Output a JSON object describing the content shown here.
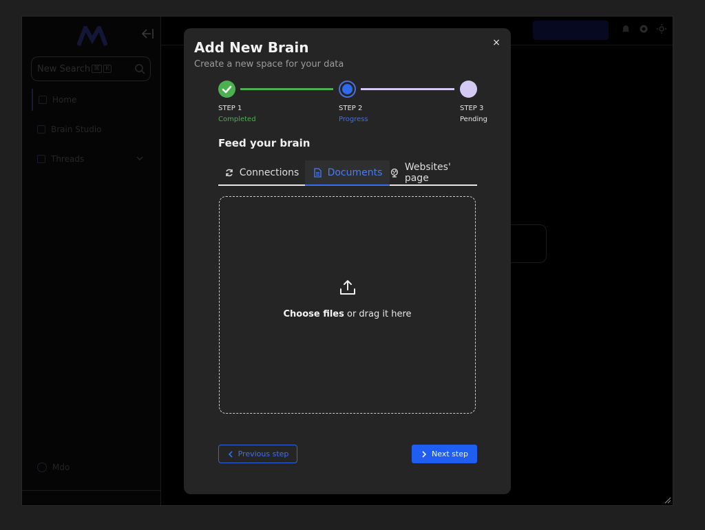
{
  "background_app": {
    "search_placeholder": "New Search",
    "search_shortcut": [
      "⌘",
      "K"
    ],
    "nav_items": [
      {
        "label": "Home",
        "icon": "home-icon"
      },
      {
        "label": "Brain Studio",
        "icon": "brain-icon"
      },
      {
        "label": "Threads",
        "icon": "threads-icon"
      }
    ],
    "user_name": "Mdo",
    "top_button_label": "",
    "accent_color": "#1f5ef0"
  },
  "modal": {
    "title": "Add New Brain",
    "subtitle": "Create a new space for your data",
    "close_glyph": "×",
    "steps": [
      {
        "label": "STEP 1",
        "status": "Completed",
        "status_color": "#4caf50"
      },
      {
        "label": "STEP 2",
        "status": "Progress",
        "status_color": "#3c6ff0"
      },
      {
        "label": "STEP 3",
        "status": "Pending",
        "status_color": "#e6e6e6"
      }
    ],
    "section_title": "Feed your brain",
    "tabs": [
      {
        "label": "Connections",
        "icon": "sync-icon",
        "active": false
      },
      {
        "label": "Documents",
        "icon": "document-icon",
        "active": true
      },
      {
        "label": "Websites' page",
        "icon": "globe-icon",
        "active": false
      }
    ],
    "dropzone": {
      "icon": "upload-icon",
      "primary": "Choose files",
      "secondary": " or drag it here"
    },
    "previous_label": "Previous step",
    "next_label": "Next step"
  }
}
